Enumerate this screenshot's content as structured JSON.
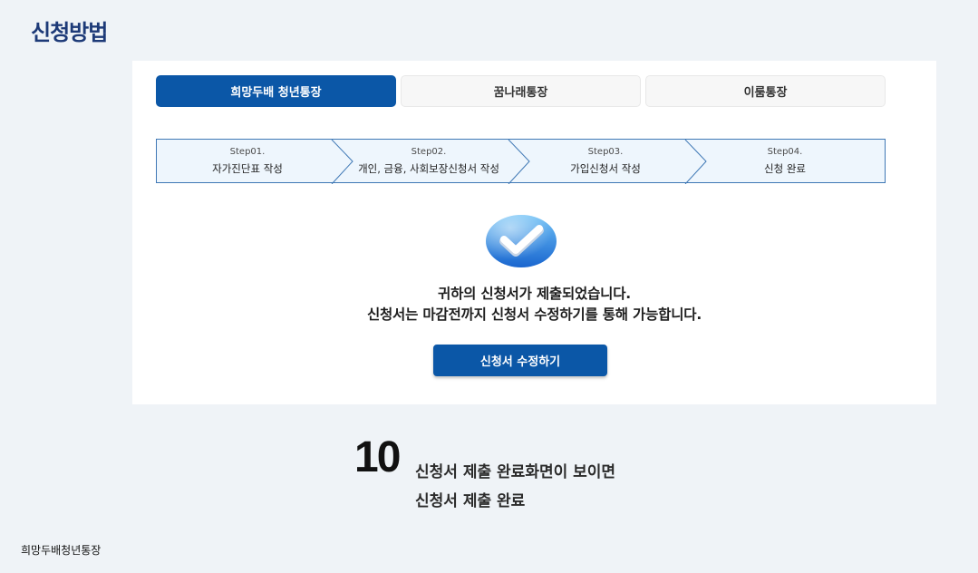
{
  "page_title": "신청방법",
  "tabs": [
    {
      "label": "희망두배 청년통장",
      "active": true
    },
    {
      "label": "꿈나래통장",
      "active": false
    },
    {
      "label": "이룸통장",
      "active": false
    }
  ],
  "steps": [
    {
      "num": "Step01.",
      "label": "자가진단표 작성"
    },
    {
      "num": "Step02.",
      "label": "개인, 금융, 사회보장신청서 작성"
    },
    {
      "num": "Step03.",
      "label": "가입신청서 작성"
    },
    {
      "num": "Step04.",
      "label": "신청 완료"
    }
  ],
  "message": {
    "line1": "귀하의 신청서가 제출되었습니다.",
    "line2": "신청서는 마감전까지 신청서 수정하기를 통해 가능합니다."
  },
  "edit_button_label": "신청서 수정하기",
  "instruction": {
    "number": "10",
    "line1": "신청서 제출 완료화면이 보이면",
    "line2": "신청서 제출 완료"
  },
  "footer_text": "희망두배청년통장",
  "colors": {
    "primary": "#0b57a7",
    "title": "#1d3a78",
    "step_bg": "#eef6fd",
    "step_border": "#3f78b5",
    "check_gradient_top": "#5ab0f0",
    "check_gradient_bottom": "#1d6fd6"
  },
  "icons": {
    "completion": "check-circle-icon"
  }
}
